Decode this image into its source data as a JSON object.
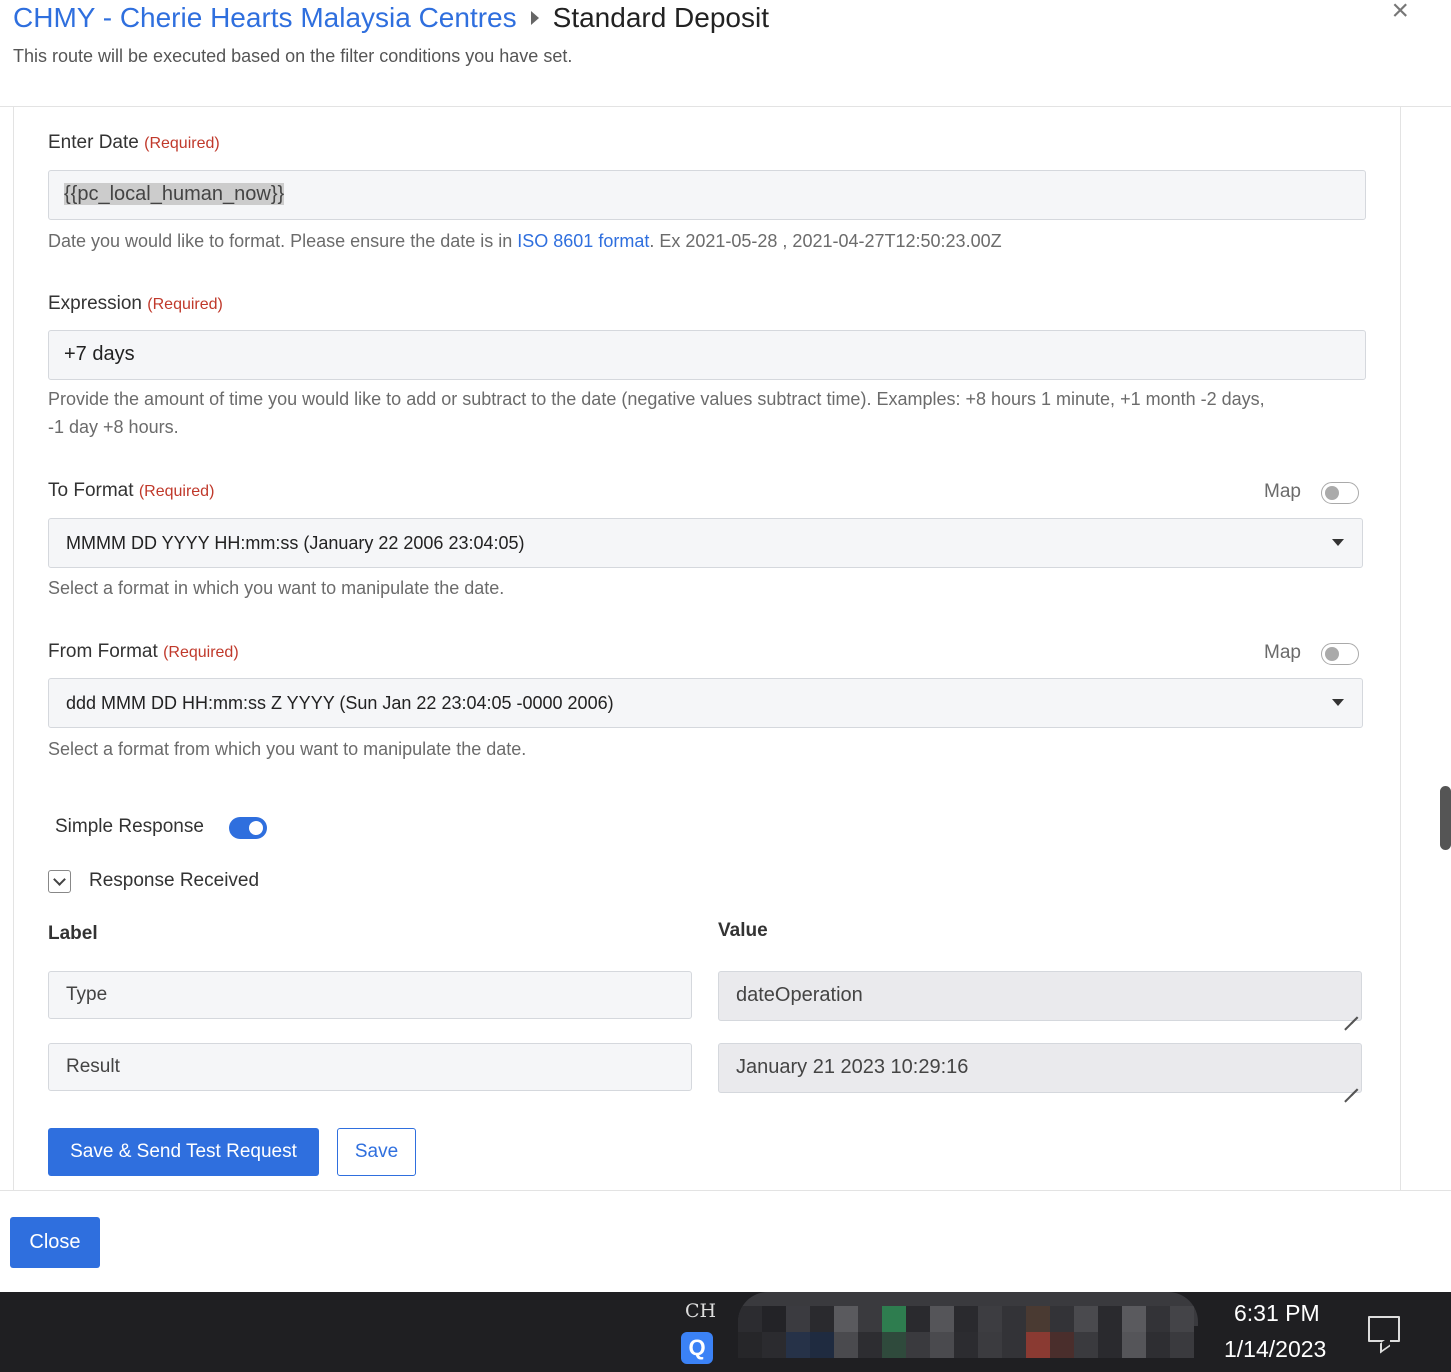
{
  "header": {
    "breadcrumb_parent": "CHMY - Cherie Hearts Malaysia Centres",
    "current_page": "Standard Deposit",
    "subtitle": "This route will be executed based on the filter conditions you have set.",
    "close_symbol": "×"
  },
  "form": {
    "required_text": "(Required)",
    "enter_date": {
      "label": "Enter Date",
      "value": "{{pc_local_human_now}}",
      "help_prefix": "Date you would like to format. Please ensure the date is in ",
      "help_link": "ISO 8601 format",
      "help_suffix": ". Ex 2021-05-28 , 2021-04-27T12:50:23.00Z"
    },
    "expression": {
      "label": "Expression",
      "value": "+7 days",
      "help_line1": "Provide the amount of time you would like to add or subtract to the date (negative values subtract time). Examples: +8 hours 1 minute, +1 month -2 days,",
      "help_line2": "-1 day +8 hours."
    },
    "to_format": {
      "label": "To Format",
      "map_label": "Map",
      "map_enabled": false,
      "selected": "MMMM DD YYYY HH:mm:ss (January 22 2006 23:04:05)",
      "help": "Select a format in which you want to manipulate the date."
    },
    "from_format": {
      "label": "From Format",
      "map_label": "Map",
      "map_enabled": false,
      "selected": "ddd MMM DD HH:mm:ss Z YYYY (Sun Jan 22 23:04:05 -0000 2006)",
      "help": "Select a format from which you want to manipulate the date."
    },
    "simple_response": {
      "label": "Simple Response",
      "enabled": true
    },
    "response_received": {
      "label": "Response Received",
      "expanded": true,
      "columns": {
        "label": "Label",
        "value": "Value"
      },
      "rows": [
        {
          "label": "Type",
          "value": "dateOperation"
        },
        {
          "label": "Result",
          "value": "January 21 2023 10:29:16"
        }
      ]
    },
    "actions": {
      "save_and_test": "Save & Send Test Request",
      "save": "Save"
    }
  },
  "footer": {
    "close_label": "Close"
  },
  "taskbar": {
    "ime": "CH",
    "tray_app_letter": "Q",
    "time": "6:31 PM",
    "date": "1/14/2023"
  },
  "colors": {
    "accent": "#2f6fde",
    "required": "#c0392b",
    "taskbar": "#1f1f22"
  }
}
